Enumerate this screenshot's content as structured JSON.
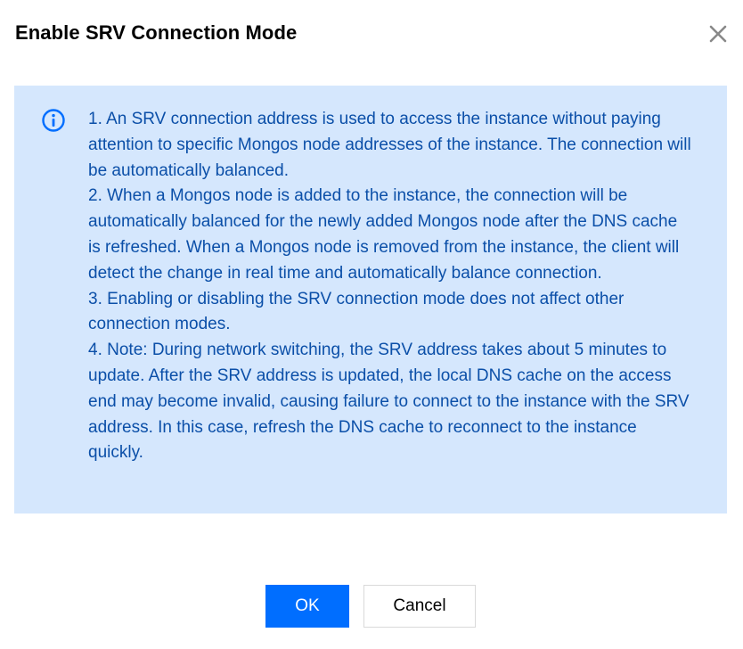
{
  "dialog": {
    "title": "Enable SRV Connection Mode",
    "close_icon": "close-icon"
  },
  "info": {
    "icon": "info-icon",
    "items": [
      "1. An SRV connection address is used to access the instance without paying attention to specific Mongos node addresses of the instance. The connection will be automatically balanced.",
      "2. When a Mongos node is added to the instance, the connection will be automatically balanced for the newly added Mongos node after the DNS cache is refreshed. When a Mongos node is removed from the instance, the client will detect the change in real time and automatically balance connection.",
      "3. Enabling or disabling the SRV connection mode does not affect other connection modes.",
      "4. Note: During network switching, the SRV address takes about 5 minutes to update. After the SRV address is updated, the local DNS cache on the access end may become invalid, causing failure to connect to the instance with the SRV address. In this case, refresh the DNS cache to reconnect to the instance quickly."
    ]
  },
  "footer": {
    "ok_label": "OK",
    "cancel_label": "Cancel"
  },
  "colors": {
    "primary": "#006eff",
    "info_bg": "#d5e7fd",
    "info_text": "#0b4fa8"
  }
}
